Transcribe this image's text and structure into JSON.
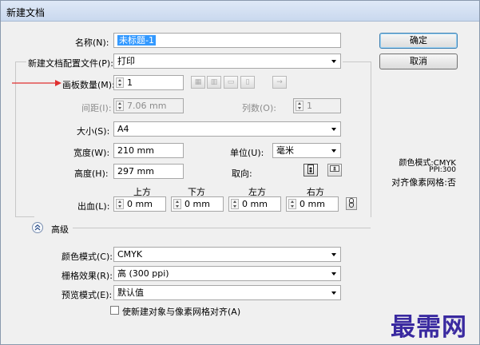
{
  "window": {
    "title": "新建文档"
  },
  "fields": {
    "name": {
      "label": "名称(N):",
      "value": "未标题-1"
    },
    "profile": {
      "label": "新建文档配置文件(P):",
      "value": "打印"
    },
    "artboards": {
      "label": "画板数量(M):",
      "value": "1"
    },
    "spacing": {
      "label": "间距(I):",
      "value": "7.06 mm"
    },
    "columns": {
      "label": "列数(O):",
      "value": "1"
    },
    "size": {
      "label": "大小(S):",
      "value": "A4"
    },
    "width": {
      "label": "宽度(W):",
      "value": "210 mm"
    },
    "units": {
      "label": "单位(U):",
      "value": "毫米"
    },
    "height": {
      "label": "高度(H):",
      "value": "297 mm"
    },
    "orientation": {
      "label": "取向:"
    },
    "bleed": {
      "label": "出血(L):",
      "top": {
        "label": "上方",
        "value": "0 mm"
      },
      "bottom": {
        "label": "下方",
        "value": "0 mm"
      },
      "left": {
        "label": "左方",
        "value": "0 mm"
      },
      "right": {
        "label": "右方",
        "value": "0 mm"
      }
    }
  },
  "advanced": {
    "label": "高级",
    "color_mode": {
      "label": "颜色模式(C):",
      "value": "CMYK"
    },
    "raster": {
      "label": "栅格效果(R):",
      "value": "高 (300 ppi)"
    },
    "preview": {
      "label": "预览模式(E):",
      "value": "默认值"
    },
    "align_pixel": {
      "label": "使新建对象与像素网格对齐(A)"
    }
  },
  "buttons": {
    "ok": "确定",
    "cancel": "取消"
  },
  "info": {
    "color_mode": "颜色模式:CMYK",
    "ppi": "PPI:300",
    "pixel_grid": "对齐像素网格:否"
  },
  "watermark": "最需网",
  "accent": {
    "selection": "#3399ff",
    "arrow": "#e03030",
    "watermark": "#3a2aa0"
  }
}
